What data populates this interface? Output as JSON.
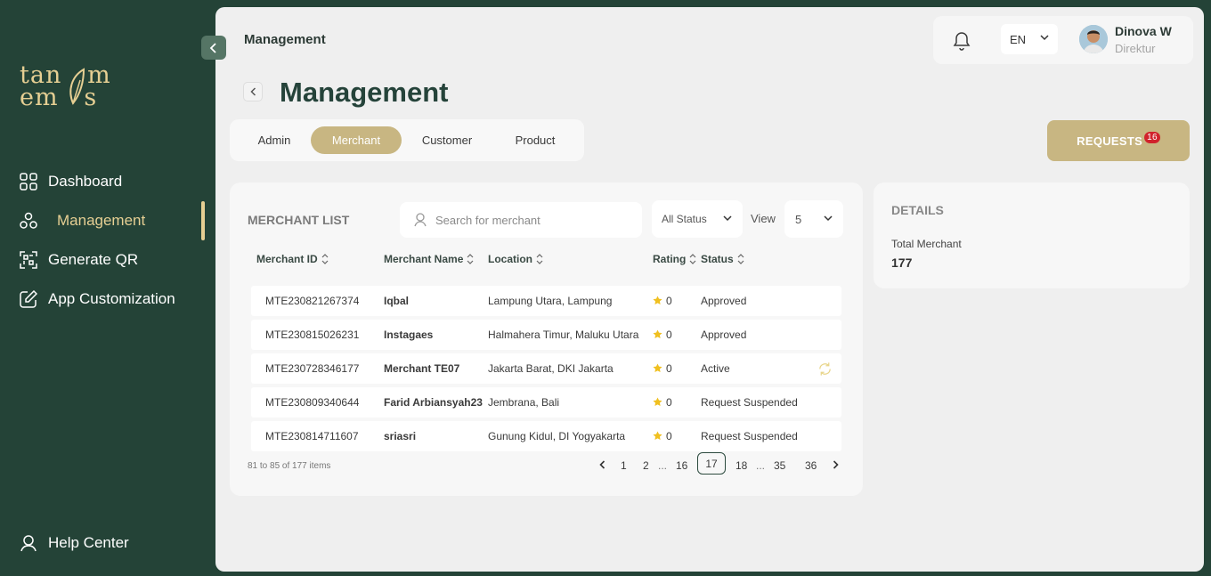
{
  "brand": {
    "line1": "tan m",
    "line2": "em s",
    "accent": "#e6cf93"
  },
  "sidebar": {
    "items": [
      {
        "label": "Dashboard",
        "icon": "grid-icon"
      },
      {
        "label": "Management",
        "icon": "nodes-icon",
        "active": true
      },
      {
        "label": "Generate QR",
        "icon": "qr-icon"
      },
      {
        "label": "App Customization",
        "icon": "edit-icon"
      }
    ],
    "help_label": "Help Center"
  },
  "header": {
    "title": "Management",
    "language": "EN",
    "user_name": "Dinova W",
    "user_role": "Direktur"
  },
  "page": {
    "title": "Management",
    "tabs": [
      "Admin",
      "Merchant",
      "Customer",
      "Product"
    ],
    "active_tab": "Merchant",
    "requests_label": "REQUESTS",
    "requests_count": "16"
  },
  "merchant_list": {
    "title": "MERCHANT LIST",
    "search_placeholder": "Search for merchant",
    "status_filter": "All Status",
    "view_label": "View",
    "view_value": "5",
    "columns": [
      "Merchant ID",
      "Merchant Name",
      "Location",
      "Rating",
      "Status"
    ],
    "rows": [
      {
        "id": "MTE230821267374",
        "name": "Iqbal",
        "location": "Lampung Utara, Lampung",
        "rating": "0",
        "status": "Approved"
      },
      {
        "id": "MTE230815026231",
        "name": "Instagaes",
        "location": "Halmahera Timur, Maluku Utara",
        "rating": "0",
        "status": "Approved"
      },
      {
        "id": "MTE230728346177",
        "name": "Merchant TE07",
        "location": "Jakarta Barat, DKI Jakarta",
        "rating": "0",
        "status": "Active"
      },
      {
        "id": "MTE230809340644",
        "name": "Farid Arbiansyah23",
        "location": "Jembrana, Bali",
        "rating": "0",
        "status": "Request Suspended"
      },
      {
        "id": "MTE230814711607",
        "name": "sriasri",
        "location": "Gunung Kidul, DI Yogyakarta",
        "rating": "0",
        "status": "Request Suspended"
      }
    ],
    "pagination": {
      "info": "81 to 85 of 177 items",
      "pages": [
        "1",
        "2",
        "...",
        "16",
        "17",
        "18",
        "...",
        "35",
        "36"
      ],
      "current": "17"
    }
  },
  "details": {
    "title": "DETAILS",
    "total_label": "Total Merchant",
    "total_value": "177"
  }
}
